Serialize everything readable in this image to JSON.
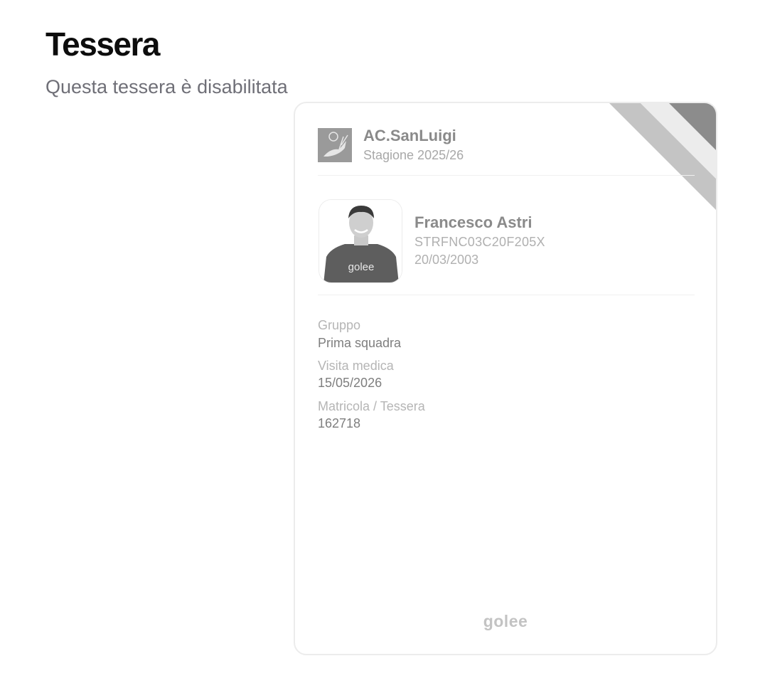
{
  "page": {
    "title": "Tessera",
    "subtitle": "Questa tessera è disabilitata"
  },
  "card": {
    "club": {
      "name": "AC.SanLuigi",
      "season": "Stagione 2025/26",
      "logo_icon": "club-logo-gazelle"
    },
    "person": {
      "name": "Francesco Astri",
      "fiscal_code": "STRFNC03C20F205X",
      "birth_date": "20/03/2003",
      "shirt_text": "golee"
    },
    "fields": [
      {
        "label": "Gruppo",
        "value": "Prima squadra"
      },
      {
        "label": "Visita medica",
        "value": "15/05/2026"
      },
      {
        "label": "Matricola / Tessera",
        "value": "162718"
      }
    ],
    "brand": "golee",
    "status": "disabled"
  },
  "colors": {
    "ribbon_dark": "#8c8c8c",
    "ribbon_mid": "#c4c4c4",
    "ribbon_light": "#ececec"
  }
}
